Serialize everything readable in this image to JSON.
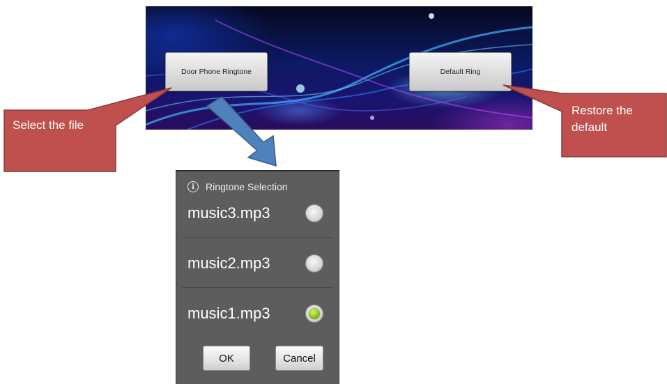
{
  "app": {
    "door_button_label": "Door Phone Ringtone",
    "default_button_label": "Default Ring"
  },
  "callouts": {
    "select_file": "Select the file",
    "restore_default_line1": "Restore the",
    "restore_default_line2": "default"
  },
  "dialog": {
    "title": "Ringtone Selection",
    "info_icon": "info-icon",
    "options": [
      {
        "label": "music3.mp3",
        "selected": false
      },
      {
        "label": "music2.mp3",
        "selected": false
      },
      {
        "label": "music1.mp3",
        "selected": true
      }
    ],
    "ok_label": "OK",
    "cancel_label": "Cancel"
  },
  "colors": {
    "callout_fill": "#c0504d",
    "arrow_fill": "#4f81bd",
    "dialog_bg": "#5d5d5d",
    "radio_selected": "#8ec21f"
  }
}
